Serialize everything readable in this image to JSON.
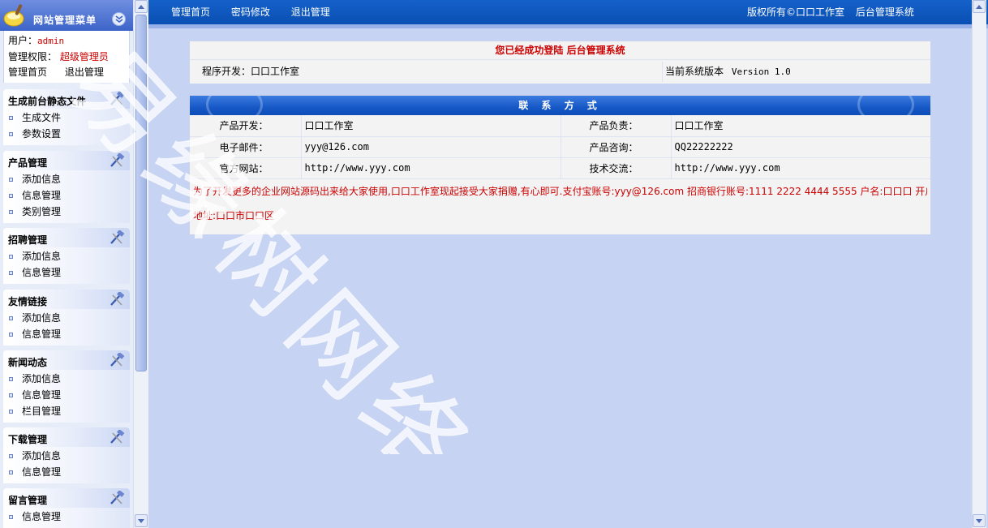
{
  "sidebar": {
    "title": "网站管理菜单",
    "user": {
      "user_label": "用户：",
      "user_name": "admin",
      "perm_label": "管理权限：",
      "perm_value": "超级管理员",
      "home_link": "管理首页",
      "logout_link": "退出管理"
    },
    "sections": [
      {
        "title": "生成前台静态文件",
        "items": [
          "生成文件",
          "参数设置"
        ]
      },
      {
        "title": "产品管理",
        "items": [
          "添加信息",
          "信息管理",
          "类别管理"
        ]
      },
      {
        "title": "招聘管理",
        "items": [
          "添加信息",
          "信息管理"
        ]
      },
      {
        "title": "友情链接",
        "items": [
          "添加信息",
          "信息管理"
        ]
      },
      {
        "title": "新闻动态",
        "items": [
          "添加信息",
          "信息管理",
          "栏目管理"
        ]
      },
      {
        "title": "下载管理",
        "items": [
          "添加信息",
          "信息管理"
        ]
      },
      {
        "title": "留言管理",
        "items": [
          "信息管理"
        ]
      }
    ]
  },
  "topbar": {
    "nav": [
      "管理首页",
      "密码修改",
      "退出管理"
    ],
    "copyright": "版权所有©口口工作室",
    "system_name": "后台管理系统"
  },
  "login_panel": {
    "welcome": "您已经成功登陆 后台管理系统",
    "developer": "程序开发：口口工作室",
    "version_label": "当前系统版本",
    "version_value": "Version 1.0"
  },
  "contact_panel": {
    "title": "联 系 方 式",
    "rows": [
      {
        "l1": "产品开发：",
        "v1": "口口工作室",
        "l2": "产品负责：",
        "v2": "口口工作室"
      },
      {
        "l1": "电子邮件：",
        "v1": "yyy@126.com",
        "l2": "产品咨询：",
        "v2": "QQ22222222"
      },
      {
        "l1": "官方网站：",
        "v1": "http://www.yyy.com",
        "l2": "技术交流：",
        "v2": "http://www.yyy.com"
      }
    ],
    "notice_line1": "为了开发更多的企业网站源码出来给大家使用,口口工作室现起接受大家捐赠,有心即可.支付宝账号:yyy@126.com 招商银行账号:1111 2222 4444 5555 户名:口口口 开户",
    "notice_line2": "地址:口口市口口区"
  },
  "watermark": {
    "text": "易缘树网络"
  },
  "colors": {
    "topbar": "#0a4fb3",
    "accent_red": "#cc0000",
    "background": "#c6d3f2"
  }
}
